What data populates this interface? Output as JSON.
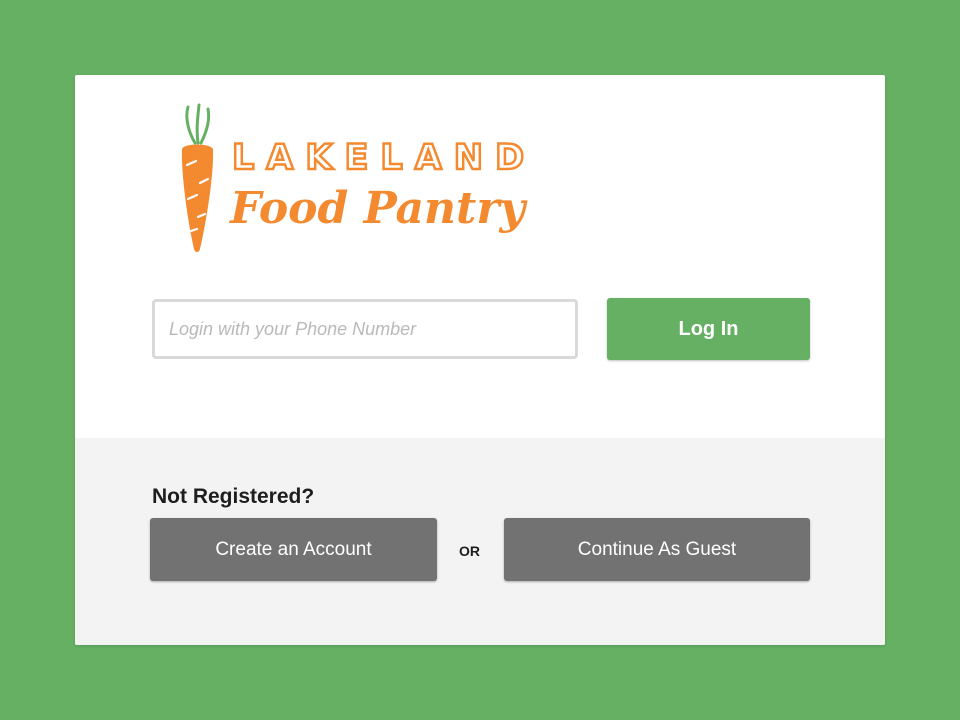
{
  "brand": {
    "line1": "LAKELAND",
    "line2": "Food Pantry",
    "primary_color": "#f48a2f",
    "leaf_color": "#66b064"
  },
  "login": {
    "phone_placeholder": "Login with your Phone Number",
    "phone_value": "",
    "login_label": "Log In"
  },
  "register": {
    "heading": "Not Registered?",
    "create_label": "Create an Account",
    "separator": "OR",
    "guest_label": "Continue As Guest"
  },
  "colors": {
    "background": "#66b064",
    "login_button": "#66b064",
    "secondary_button": "#727272",
    "bottom_panel": "#f3f3f4"
  }
}
